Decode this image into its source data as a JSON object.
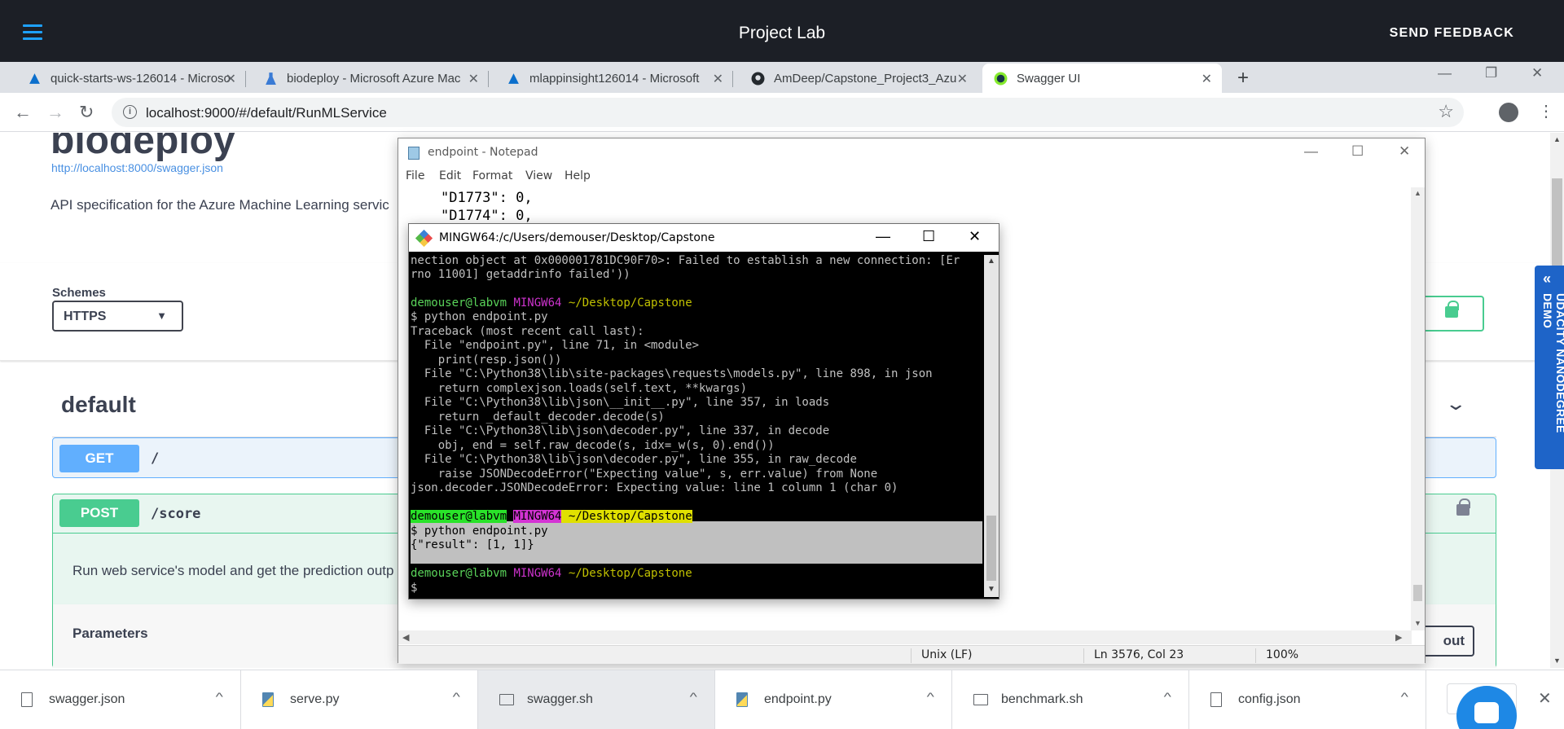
{
  "appbar": {
    "title": "Project Lab",
    "feedback": "SEND FEEDBACK"
  },
  "tabs": [
    {
      "label": "quick-starts-ws-126014 - Microso",
      "icon": "azure-ml-icon"
    },
    {
      "label": "biodeploy - Microsoft Azure Mac",
      "icon": "flask-icon"
    },
    {
      "label": "mlappinsight126014 - Microsoft",
      "icon": "azure-ml-icon"
    },
    {
      "label": "AmDeep/Capstone_Project3_Azu",
      "icon": "github-icon"
    },
    {
      "label": "Swagger UI",
      "icon": "swagger-icon"
    }
  ],
  "tab_close": "✕",
  "new_tab": "+",
  "addressbar": {
    "url": "localhost:9000/#/default/RunMLService"
  },
  "swagger": {
    "api_title": "biodeploy",
    "api_link": "http://localhost:8000/swagger.json",
    "api_desc": "API specification for the Azure Machine Learning servic",
    "schemes_label": "Schemes",
    "scheme_selected": "HTTPS",
    "section": "default",
    "get": {
      "method": "GET",
      "path": "/"
    },
    "post": {
      "method": "POST",
      "path": "/score",
      "desc": "Run web service's model and get the prediction outp"
    },
    "params_label": "Parameters",
    "tryout_label": "out"
  },
  "udacity_tab": "UDACITY NANODEGREE DEMO",
  "notepad": {
    "title": "endpoint - Notepad",
    "menu": [
      "File",
      "Edit",
      "Format",
      "View",
      "Help"
    ],
    "lines": [
      "\"D1773\": 0,",
      "\"D1774\": 0,"
    ],
    "status": {
      "eol": "Unix (LF)",
      "position": "Ln 3576, Col 23",
      "zoom": "100%"
    }
  },
  "mingw": {
    "title": "MINGW64:/c/Users/demouser/Desktop/Capstone",
    "prompt_user": "demouser@labvm",
    "prompt_sys": "MINGW64",
    "prompt_path": "~/Desktop/Capstone",
    "lines": [
      "nection object at 0x000001781DC90F70>: Failed to establish a new connection: [Er",
      "rno 11001] getaddrinfo failed'))",
      "$ python endpoint.py",
      "Traceback (most recent call last):",
      "  File \"endpoint.py\", line 71, in <module>",
      "    print(resp.json())",
      "  File \"C:\\Python38\\lib\\site-packages\\requests\\models.py\", line 898, in json",
      "    return complexjson.loads(self.text, **kwargs)",
      "  File \"C:\\Python38\\lib\\json\\__init__.py\", line 357, in loads",
      "    return _default_decoder.decode(s)",
      "  File \"C:\\Python38\\lib\\json\\decoder.py\", line 337, in decode",
      "    obj, end = self.raw_decode(s, idx=_w(s, 0).end())",
      "  File \"C:\\Python38\\lib\\json\\decoder.py\", line 355, in raw_decode",
      "    raise JSONDecodeError(\"Expecting value\", s, err.value) from None",
      "json.decoder.JSONDecodeError: Expecting value: line 1 column 1 (char 0)",
      "$ python endpoint.py",
      "{\"result\": [1, 1]}",
      "$"
    ]
  },
  "downloads": [
    {
      "name": "swagger.json",
      "icon": "file-icon"
    },
    {
      "name": "serve.py",
      "icon": "python-file-icon"
    },
    {
      "name": "swagger.sh",
      "icon": "script-file-icon"
    },
    {
      "name": "endpoint.py",
      "icon": "python-file-icon"
    },
    {
      "name": "benchmark.sh",
      "icon": "script-file-icon"
    },
    {
      "name": "config.json",
      "icon": "file-icon"
    }
  ],
  "show_all": "Show",
  "colors": {
    "appbar": "#1c1f26",
    "get": "#61affe",
    "post": "#49cc90",
    "udacity": "#1e64c8"
  }
}
